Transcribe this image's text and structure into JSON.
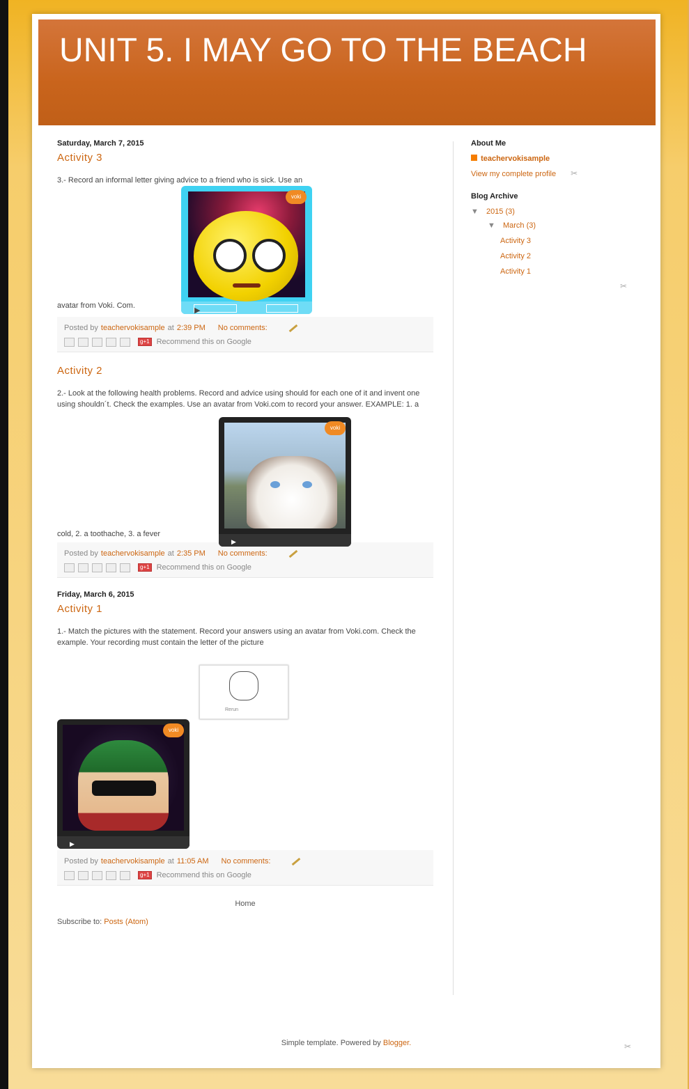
{
  "blog": {
    "title": "UNIT 5. I MAY GO TO THE BEACH",
    "home_link": "Home",
    "subscribe_prefix": "Subscribe to:",
    "subscribe_link": "Posts (Atom)",
    "footer_text": "Simple template. Powered by",
    "footer_link": "Blogger."
  },
  "posts": [
    {
      "date": "Saturday, March 7, 2015",
      "title": "Activity 3",
      "body_line1": "3.- Record an informal letter giving advice to a friend who is sick. Use an",
      "body_tail": "avatar from Voki. Com.",
      "posted_by": "Posted by",
      "author": "teachervokisample",
      "at": "at",
      "time": "2:39 PM",
      "comments": "No comments:",
      "recommend": "Recommend this on Google"
    },
    {
      "title": "Activity 2",
      "body": "2.- Look at the following health problems. Record and advice using should for each one of it and invent one using shouldn´t. Check the examples. Use an avatar from Voki.com to record your answer. EXAMPLE: 1. a",
      "body_tail": "cold, 2. a toothache, 3. a fever",
      "posted_by": "Posted by",
      "author": "teachervokisample",
      "at": "at",
      "time": "2:35 PM",
      "comments": "No comments:",
      "recommend": "Recommend this on Google"
    },
    {
      "date": "Friday, March 6, 2015",
      "title": "Activity 1",
      "body": "1.- Match the pictures with the statement. Record your answers using an avatar from Voki.com. Check the example. Your recording must contain the letter of the picture",
      "image_caption": "Rerun",
      "posted_by": "Posted by",
      "author": "teachervokisample",
      "at": "at",
      "time": "11:05 AM",
      "comments": "No comments:",
      "recommend": "Recommend this on Google"
    }
  ],
  "voki_badge": "voki",
  "sidebar": {
    "about_heading": "About Me",
    "profile_name": "teachervokisample",
    "profile_link": "View my complete profile",
    "archive_heading": "Blog Archive",
    "year": "2015 (3)",
    "month": "March (3)",
    "archive_items": [
      "Activity 3",
      "Activity 2",
      "Activity 1"
    ]
  }
}
